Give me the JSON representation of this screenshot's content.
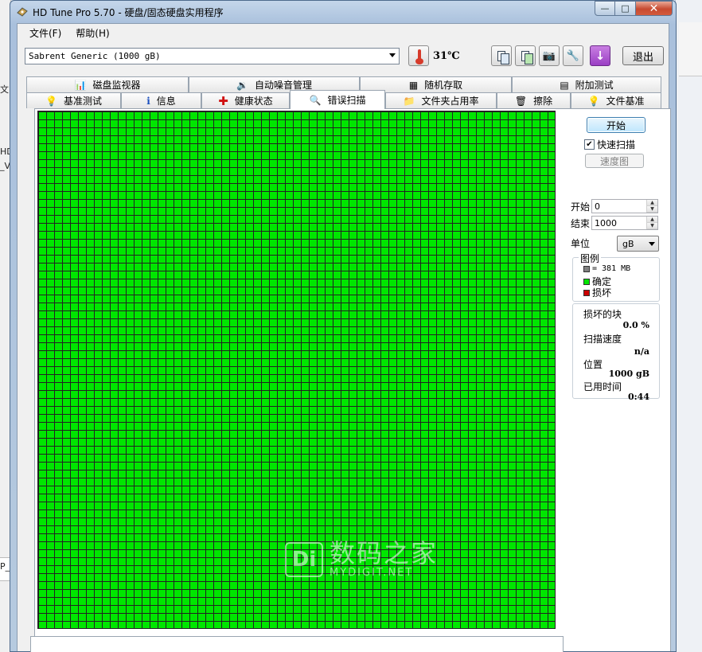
{
  "background": {
    "fragments": [
      "文",
      "HD",
      "_V",
      "P_"
    ]
  },
  "window": {
    "title": "HD Tune Pro 5.70 - 硬盘/固态硬盘实用程序",
    "minimize_glyph": "—",
    "maximize_glyph": "□",
    "close_glyph": "✕"
  },
  "menu": {
    "items": [
      "文件(F)",
      "帮助(H)"
    ]
  },
  "toolbar": {
    "drive_selected": "Sabrent Generic (1000 gB)",
    "temperature": "31℃",
    "exit_label": "退出"
  },
  "tabs": {
    "top": [
      "磁盘监视器",
      "自动噪音管理",
      "随机存取",
      "附加测试"
    ],
    "bottom": [
      "基准测试",
      "信息",
      "健康状态",
      "错误扫描",
      "文件夹占用率",
      "擦除",
      "文件基准"
    ],
    "active": "错误扫描"
  },
  "scan": {
    "start_label": "开始",
    "quick_scan_label": "快速扫描",
    "quick_scan_checked": true,
    "speed_map_label": "速度图",
    "start_field_label": "开始",
    "start_value": "0",
    "end_field_label": "结束",
    "end_value": "1000",
    "unit_label": "单位",
    "unit_value": "gB",
    "legend": {
      "title": "图例",
      "block_size": "= 381 MB",
      "ok_label": "确定",
      "bad_label": "损坏"
    },
    "stats": {
      "damaged_blocks_label": "损坏的块",
      "damaged_blocks_value": "0.0 %",
      "scan_speed_label": "扫描速度",
      "scan_speed_value": "n/a",
      "position_label": "位置",
      "position_value": "1000 gB",
      "elapsed_label": "已用时间",
      "elapsed_value": "0:44"
    },
    "block_status": "all ok",
    "grid_columns": 65,
    "grid_rows": 65
  },
  "watermark": {
    "logo": "Di",
    "cn": "数码之家",
    "en": "MYDIGIT.NET"
  },
  "colors": {
    "ok_block": "#00e600",
    "bad_block": "#cc0000",
    "legend_block": "#808080",
    "accent_button": "#bee6fd"
  }
}
